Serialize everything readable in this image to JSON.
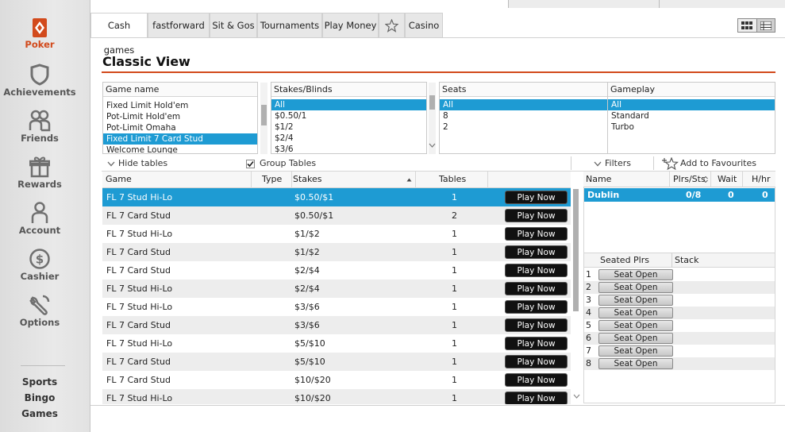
{
  "sidebar": {
    "items": [
      {
        "label": "Poker",
        "icon": "poker-diamond-icon",
        "active": true
      },
      {
        "label": "Achievements",
        "icon": "shield-icon"
      },
      {
        "label": "Friends",
        "icon": "friends-icon"
      },
      {
        "label": "Rewards",
        "icon": "gift-icon"
      },
      {
        "label": "Account",
        "icon": "person-icon"
      },
      {
        "label": "Cashier",
        "icon": "dollar-coin-icon"
      },
      {
        "label": "Options",
        "icon": "wrench-icon"
      }
    ],
    "bottom_links": [
      "Sports",
      "Bingo",
      "Games"
    ],
    "accent": "#d24a1c"
  },
  "tabs": [
    "Cash games",
    "fastforward",
    "Sit & Gos",
    "Tournaments",
    "Play Money",
    "",
    "Casino"
  ],
  "tab_favourites_icon": "star-icon",
  "page_title": "Classic View",
  "filters": {
    "game_name": {
      "header": "Game name",
      "options": [
        "Fixed Limit Hold'em",
        "Pot-Limit Hold'em",
        "Pot-Limit Omaha",
        "Fixed Limit 7 Card Stud",
        "Welcome Lounge"
      ],
      "selected": "Fixed Limit 7 Card Stud"
    },
    "stakes": {
      "header": "Stakes/Blinds",
      "options": [
        "All",
        "$0.50/1",
        "$1/2",
        "$2/4",
        "$3/6"
      ],
      "selected": "All"
    },
    "seats": {
      "header": "Seats",
      "options": [
        "All",
        "8",
        "2"
      ],
      "selected": "All"
    },
    "gameplay": {
      "header": "Gameplay",
      "options": [
        "All",
        "Standard",
        "Turbo"
      ],
      "selected": "All"
    }
  },
  "toolbar": {
    "hide_tables": "Hide tables",
    "group_tables": "Group Tables",
    "group_tables_checked": true,
    "filters": "Filters",
    "add_favourites": "Add to Favourites"
  },
  "table": {
    "headers": {
      "game": "Game",
      "type": "Type",
      "stakes": "Stakes",
      "tables": "Tables"
    },
    "play_label": "Play Now",
    "rows": [
      {
        "game": "FL 7 Stud Hi-Lo",
        "stakes": "$0.50/$1",
        "tables": "1",
        "selected": true
      },
      {
        "game": "FL 7 Card Stud",
        "stakes": "$0.50/$1",
        "tables": "2"
      },
      {
        "game": "FL 7 Stud Hi-Lo",
        "stakes": "$1/$2",
        "tables": "1"
      },
      {
        "game": "FL 7 Card Stud",
        "stakes": "$1/$2",
        "tables": "1"
      },
      {
        "game": "FL 7 Card Stud",
        "stakes": "$2/$4",
        "tables": "1"
      },
      {
        "game": "FL 7 Stud Hi-Lo",
        "stakes": "$2/$4",
        "tables": "1"
      },
      {
        "game": "FL 7 Stud Hi-Lo",
        "stakes": "$3/$6",
        "tables": "1"
      },
      {
        "game": "FL 7 Card Stud",
        "stakes": "$3/$6",
        "tables": "1"
      },
      {
        "game": "FL 7 Stud Hi-Lo",
        "stakes": "$5/$10",
        "tables": "1"
      },
      {
        "game": "FL 7 Card Stud",
        "stakes": "$5/$10",
        "tables": "1"
      },
      {
        "game": "FL 7 Card Stud",
        "stakes": "$10/$20",
        "tables": "1"
      },
      {
        "game": "FL 7 Stud Hi-Lo",
        "stakes": "$10/$20",
        "tables": "1"
      }
    ]
  },
  "right_panel": {
    "headers": {
      "name": "Name",
      "plrs": "Plrs/Sts",
      "wait": "Wait",
      "hhr": "H/hr"
    },
    "rows": [
      {
        "name": "Dublin",
        "plrs": "0/8",
        "wait": "0",
        "hhr": "0"
      }
    ],
    "seat_headers": {
      "seated": "Seated Plrs",
      "stack": "Stack"
    },
    "seats": [
      {
        "n": "1",
        "label": "Seat Open"
      },
      {
        "n": "2",
        "label": "Seat Open"
      },
      {
        "n": "3",
        "label": "Seat Open"
      },
      {
        "n": "4",
        "label": "Seat Open"
      },
      {
        "n": "5",
        "label": "Seat Open"
      },
      {
        "n": "6",
        "label": "Seat Open"
      },
      {
        "n": "7",
        "label": "Seat Open"
      },
      {
        "n": "8",
        "label": "Seat Open"
      }
    ]
  },
  "colors": {
    "selection": "#1e9bd3",
    "title_rule": "#d24a1c"
  }
}
